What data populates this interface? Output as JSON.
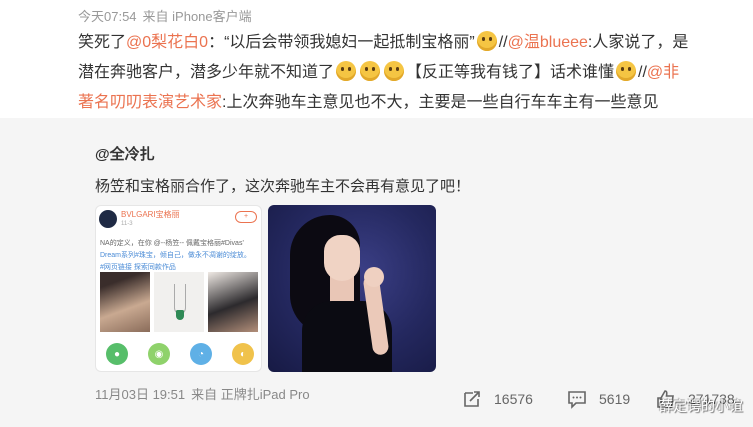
{
  "post": {
    "timestamp": "今天07:54",
    "source": "来自 iPhone客户端",
    "line1": {
      "t1": "笑死了",
      "m1": "@0梨花白0",
      "t2": "：“以后会带领我媳妇一起抵制宝格丽”",
      "t3": "//",
      "m2": "@温blueee",
      "t4": ":人家说了，是"
    },
    "line2": {
      "t1": "潜在奔驰客户，潜多少年就不知道了",
      "t2": "【反正等我有钱了】话术谁懂",
      "t3": "//",
      "m1": "@非"
    },
    "line3": {
      "m1": "著名叨叨表演艺术家",
      "t1": ":上次奔驰车主意见也不大，主要是一些自行车车主有一些意见"
    },
    "emoji_name": "doge-emoji"
  },
  "repost": {
    "author": "@全冷扎",
    "text": "杨笠和宝格丽合作了，这次奔驰车主不会再有意见了吧！",
    "thumb1": {
      "account_name": "BVLGARI宝格丽",
      "time": "11-3",
      "follow": "+",
      "body_line1": "NA的定义，在你 @--杨笠-- 佩戴宝格丽#Divas'",
      "body_line2": "Dream系列#珠宝，倾自己，做永不凋谢的绽放。",
      "body_line3": "#网页链接 探索同款作品",
      "icons": [
        "wechat-icon",
        "moments-icon",
        "qq-icon",
        "weibo-icon"
      ]
    }
  },
  "footer": {
    "timestamp": "11月03日 19:51",
    "source": "来自 正牌扎iPad Pro",
    "reposts": "16576",
    "comments": "5619",
    "likes": "271738"
  },
  "watermark": "薛定谔的小谊",
  "colors": {
    "mention": "#eb7350",
    "repost_bg": "#f5f5f5",
    "link": "#4a8bd6"
  }
}
